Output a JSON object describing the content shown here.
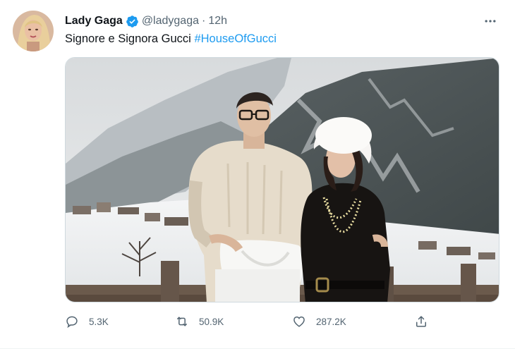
{
  "tweet": {
    "author": {
      "display_name": "Lady Gaga",
      "handle": "@ladygaga",
      "separator": "·",
      "time": "12h",
      "verified": true,
      "avatar_icon": "avatar-photo"
    },
    "text_plain": "Signore e Signora Gucci",
    "hashtag": "#HouseOfGucci",
    "media_icon": "photo-snowy-mountain-couple",
    "actions": {
      "reply_count": "5.3K",
      "retweet_count": "50.9K",
      "like_count": "287.2K"
    }
  },
  "colors": {
    "accent": "#1d9bf0",
    "text": "#0f1419",
    "muted": "#536471"
  }
}
